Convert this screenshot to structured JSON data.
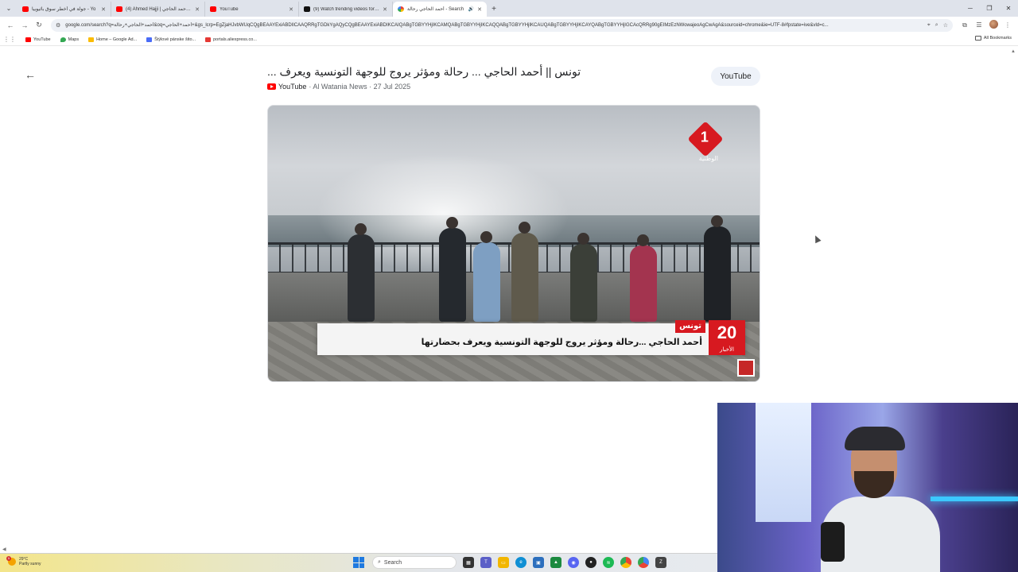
{
  "browser": {
    "tabs": [
      {
        "title": "جولة في أخطر سوق بأثيوبيا - Yo",
        "favicon": "youtube-icon",
        "active": false
      },
      {
        "title": "(4) Ahmed Hajji | أحمد الحاجي - Y",
        "favicon": "youtube-icon",
        "active": false
      },
      {
        "title": "YouTube",
        "favicon": "youtube-icon",
        "active": false
      },
      {
        "title": "(9) Watch trending videos for yo",
        "favicon": "tiktok-icon",
        "active": false
      },
      {
        "title": "أحمد الحاجي رحالة - Search",
        "favicon": "google-icon",
        "active": true
      }
    ],
    "address_url": "google.com/search?q=أحمد+الحاجي+رحالة&oq=أحمد+الحاجي+&gs_lcrp=EgZjaHJvbWUqCQgBEAAYExiABDIlCAAQRRgTGDkYgAQyCQgBEAAYExiABDIKCAIQABgTGBYYHjIKCAMQABgTGBYYHjIKCAQQABgTGBYYHjIKCAUQABgTGBYYHjIKCAYQABgTGBYYHjIGCAcQRRg90gEIMzEzNWowajeoAgCwAgA&sourceid=chrome&ie=UTF-8#fpstate=ive&vld=c...",
    "bookmarks": [
      {
        "label": "YouTube",
        "color": "#ff0000"
      },
      {
        "label": "Maps",
        "color": "#34a853"
      },
      {
        "label": "Home – Google Ad...",
        "color": "#fbbc05"
      },
      {
        "label": "Štýlové pánske šito...",
        "color": "#4a6cf7"
      },
      {
        "label": "portals.aliexpress.co...",
        "color": "#e53935"
      }
    ],
    "all_bookmarks_label": "All Bookmarks"
  },
  "video": {
    "title": "تونس || أحمد الحاجي ... رحالة ومؤثر يروج للوجهة التونسية ويعرف ...",
    "source": "YouTube",
    "channel_date": "· Al Watania News · 27 Jul 2025",
    "chip_label": "YouTube",
    "overlay": {
      "channel_logo_number": "1",
      "channel_logo_text": "الوطنية",
      "news_number": "20",
      "news_label": "الأخبار",
      "kicker": "تونس",
      "headline": "أحمد الحاجي ...رحالة ومؤثر يروج  للوجهة التونسية ويعرف بحضارتها"
    }
  },
  "taskbar": {
    "weather_temp": "29°C",
    "weather_desc": "Partly sunny",
    "weather_badge": "1",
    "search_label": "Search"
  }
}
